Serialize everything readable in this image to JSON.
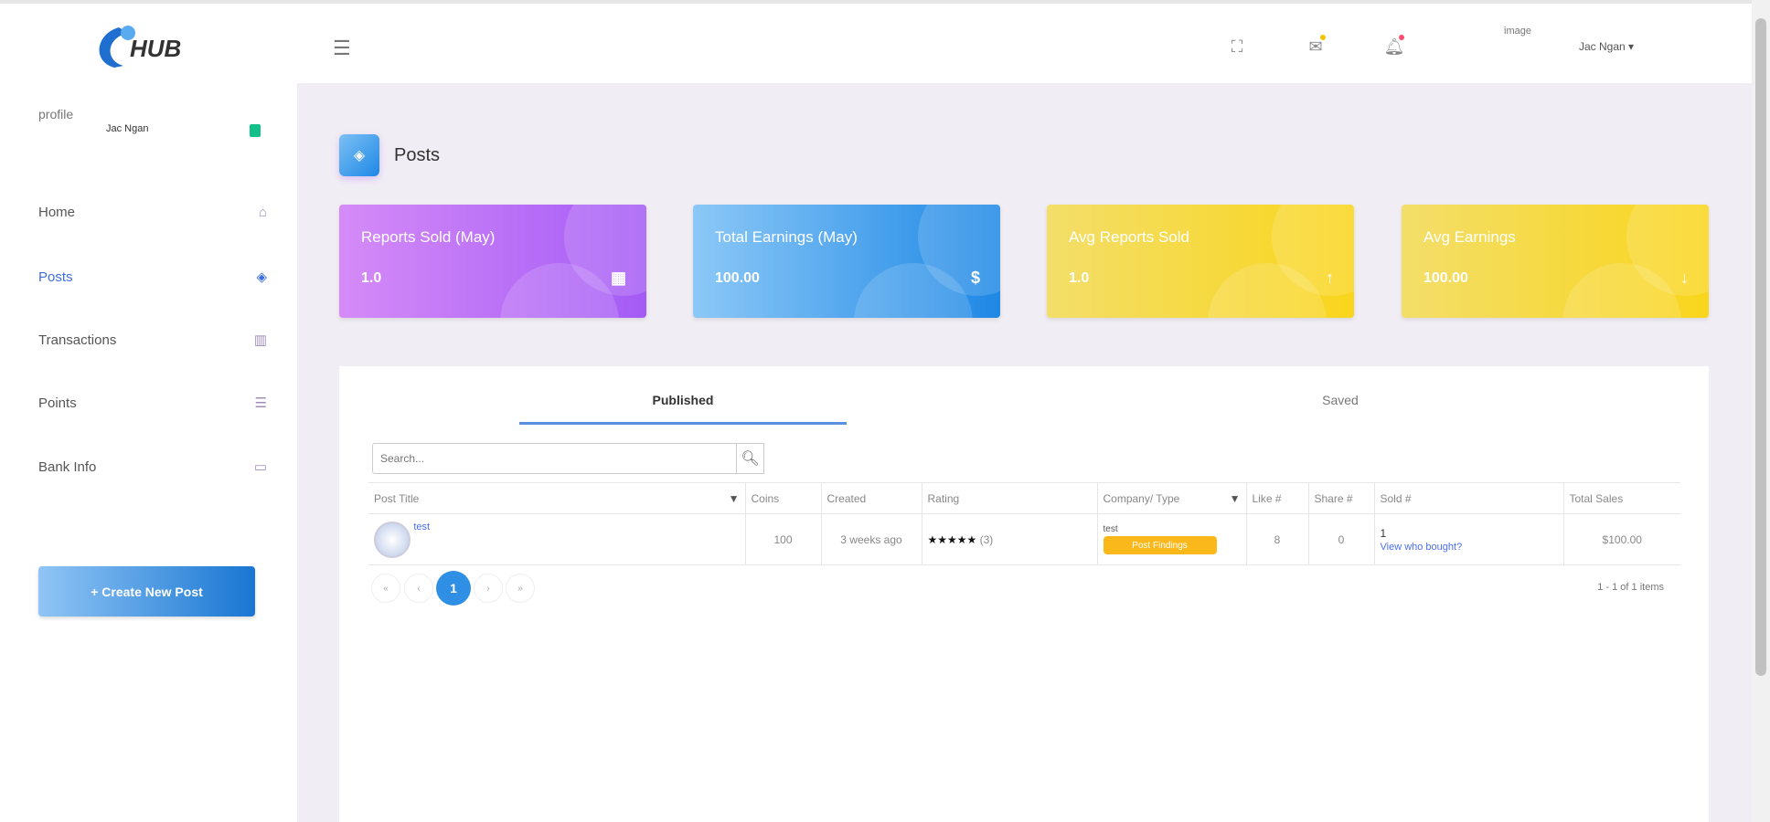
{
  "header": {
    "logo_text": "HUB",
    "avatar_alt": "image",
    "user_name": "Jac Ngan",
    "colors": {
      "mail_dot": "#f5c400",
      "bell_dot": "#ff4d6d"
    }
  },
  "sidebar": {
    "profile_alt": "profile",
    "profile_name": "Jac Ngan",
    "items": [
      {
        "label": "Home",
        "icon": "home-icon"
      },
      {
        "label": "Posts",
        "icon": "posts-icon"
      },
      {
        "label": "Transactions",
        "icon": "bar-chart-icon"
      },
      {
        "label": "Points",
        "icon": "list-icon"
      },
      {
        "label": "Bank Info",
        "icon": "card-icon"
      }
    ],
    "create_button": "+ Create New Post"
  },
  "page": {
    "title": "Posts"
  },
  "cards": [
    {
      "title": "Reports Sold (May)",
      "value": "1.0",
      "color": "#a45bf5"
    },
    {
      "title": "Total Earnings (May)",
      "value": "100.00",
      "color": "#1e88e5"
    },
    {
      "title": "Avg Reports Sold",
      "value": "1.0",
      "color": "#f7d21e"
    },
    {
      "title": "Avg Earnings",
      "value": "100.00",
      "color": "#f7d21e"
    }
  ],
  "tabs": [
    {
      "label": "Published"
    },
    {
      "label": "Saved"
    }
  ],
  "search": {
    "placeholder": "Search..."
  },
  "table": {
    "headers": [
      "Post Title",
      "Coins",
      "Created",
      "Rating",
      "Company/ Type",
      "Like #",
      "Share #",
      "Sold #",
      "Total Sales"
    ],
    "rows": [
      {
        "title": "test",
        "coins": "100",
        "created": "3 weeks ago",
        "stars": "★★★★★",
        "rating_count": "(3)",
        "company": "test",
        "type_badge": "Post Findings",
        "likes": "8",
        "shares": "0",
        "sold": "1",
        "sold_link": "View who bought?",
        "total": "$100.00"
      }
    ]
  },
  "pagination": {
    "first": "«",
    "prev": "‹",
    "current": "1",
    "next": "›",
    "last": "»",
    "summary": "1 - 1 of 1 items"
  }
}
